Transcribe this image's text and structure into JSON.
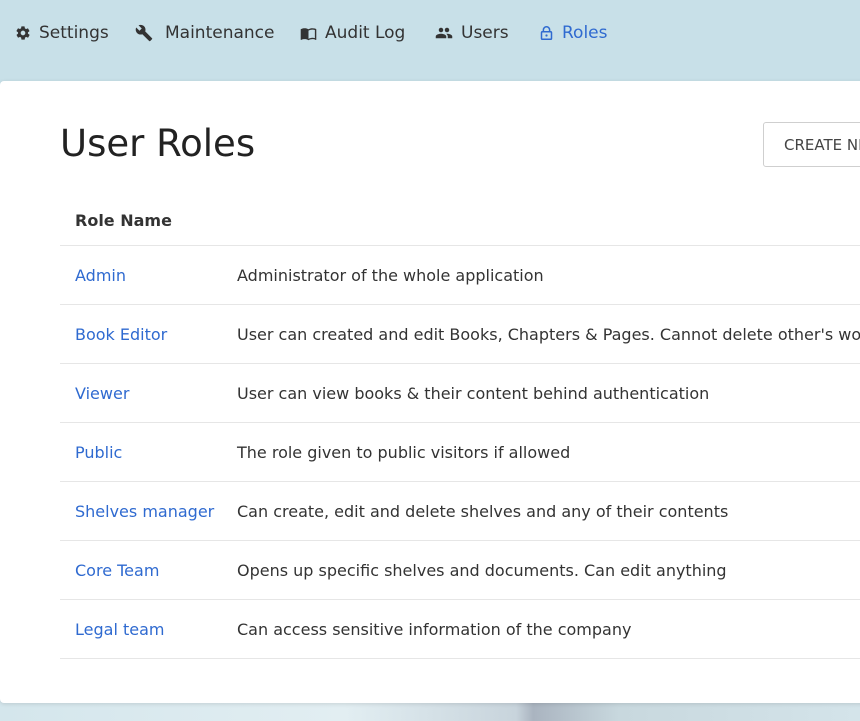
{
  "nav": {
    "items": [
      {
        "label": "Settings",
        "icon": "gear-icon"
      },
      {
        "label": "Maintenance",
        "icon": "wrench-icon"
      },
      {
        "label": "Audit Log",
        "icon": "book-icon"
      },
      {
        "label": "Users",
        "icon": "users-icon"
      },
      {
        "label": "Roles",
        "icon": "lock-icon",
        "active": true
      }
    ]
  },
  "page": {
    "title": "User Roles",
    "create_button_label": "CREATE NEW ROLE"
  },
  "table": {
    "header": "Role Name",
    "rows": [
      {
        "name": "Admin",
        "description": "Administrator of the whole application"
      },
      {
        "name": "Book Editor",
        "description": "User can created and edit Books, Chapters & Pages. Cannot delete other's work."
      },
      {
        "name": "Viewer",
        "description": "User can view books & their content behind authentication"
      },
      {
        "name": "Public",
        "description": "The role given to public visitors if allowed"
      },
      {
        "name": "Shelves manager",
        "description": "Can create, edit and delete shelves and any of their contents"
      },
      {
        "name": "Core Team",
        "description": "Opens up specific shelves and documents. Can edit anything"
      },
      {
        "name": "Legal team",
        "description": "Can access sensitive information of the company"
      }
    ]
  },
  "colors": {
    "accent": "#2f6ad0",
    "nav_background": "#c8e0e8"
  }
}
